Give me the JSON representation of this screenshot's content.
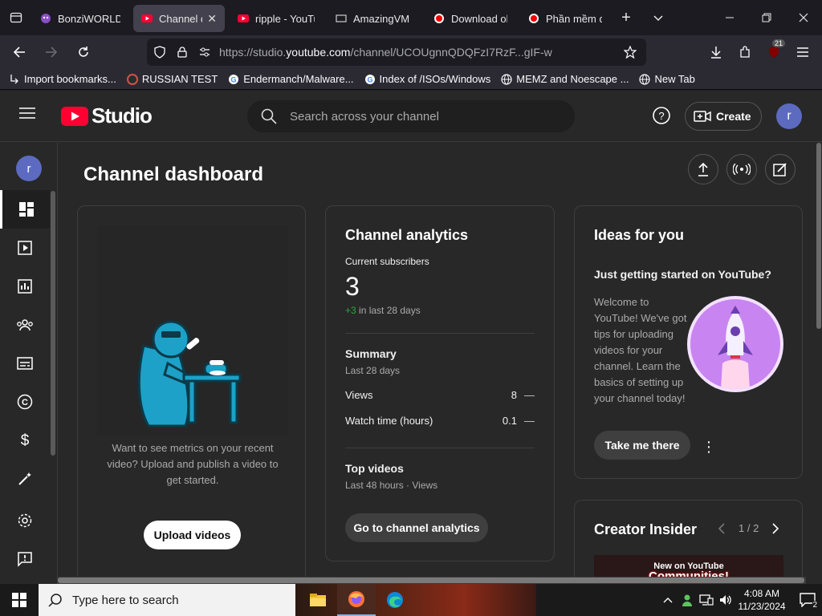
{
  "browser": {
    "tabs": [
      {
        "title": "BonziWORLD",
        "active": false,
        "icon": "bonzi-icon"
      },
      {
        "title": "Channel da",
        "active": true,
        "icon": "youtube-studio-icon"
      },
      {
        "title": "ripple - YouTu",
        "active": false,
        "icon": "youtube-icon"
      },
      {
        "title": "AmazingVM",
        "active": false,
        "icon": "amazingvm-icon"
      },
      {
        "title": "Download old",
        "active": false,
        "icon": "record-icon"
      },
      {
        "title": "Phần mềm qu",
        "active": false,
        "icon": "record-icon"
      }
    ],
    "url_prefix": "https://studio.",
    "url_domain": "youtube.com",
    "url_rest": "/channel/UCOUgnnQDQFzI7RzF...gIF-w",
    "extension_badge": "21",
    "bookmarks": [
      {
        "label": "Import bookmarks...",
        "icon": "import-icon"
      },
      {
        "label": "RUSSIAN TEST",
        "icon": "russian-test-icon"
      },
      {
        "label": "Endermanch/Malware...",
        "icon": "google-icon"
      },
      {
        "label": "Index of /ISOs/Windows",
        "icon": "google-icon"
      },
      {
        "label": "MEMZ and Noescape ...",
        "icon": "globe-icon"
      },
      {
        "label": "New Tab",
        "icon": "globe-icon"
      }
    ]
  },
  "studio": {
    "logo_text": "Studio",
    "search_placeholder": "Search across your channel",
    "create_label": "Create",
    "avatar_letter": "r",
    "page_title": "Channel dashboard",
    "upload_card": {
      "text": "Want to see metrics on your recent video? Upload and publish a video to get started.",
      "button": "Upload videos"
    },
    "analytics": {
      "title": "Channel analytics",
      "subs_label": "Current subscribers",
      "subs_value": "3",
      "subs_delta": "+3",
      "subs_delta_suffix": " in last 28 days",
      "summary_title": "Summary",
      "summary_period": "Last 28 days",
      "rows": [
        {
          "label": "Views",
          "value": "8",
          "trend": "—"
        },
        {
          "label": "Watch time (hours)",
          "value": "0.1",
          "trend": "—"
        }
      ],
      "top_title": "Top videos",
      "top_sub": "Last 48 hours · Views",
      "button": "Go to channel analytics"
    },
    "ideas": {
      "title": "Ideas for you",
      "heading": "Just getting started on YouTube?",
      "body": "Welcome to YouTube! We've got tips for uploading videos for your channel. Learn the basics of setting up your channel today!",
      "button": "Take me there"
    },
    "creator_insider": {
      "title": "Creator Insider",
      "pager": "1 / 2",
      "thumb_line1": "New on YouTube",
      "thumb_line2": "Communities!"
    }
  },
  "taskbar": {
    "search_placeholder": "Type here to search",
    "time": "4:08 AM",
    "date": "11/23/2024",
    "notification_count": "2"
  }
}
